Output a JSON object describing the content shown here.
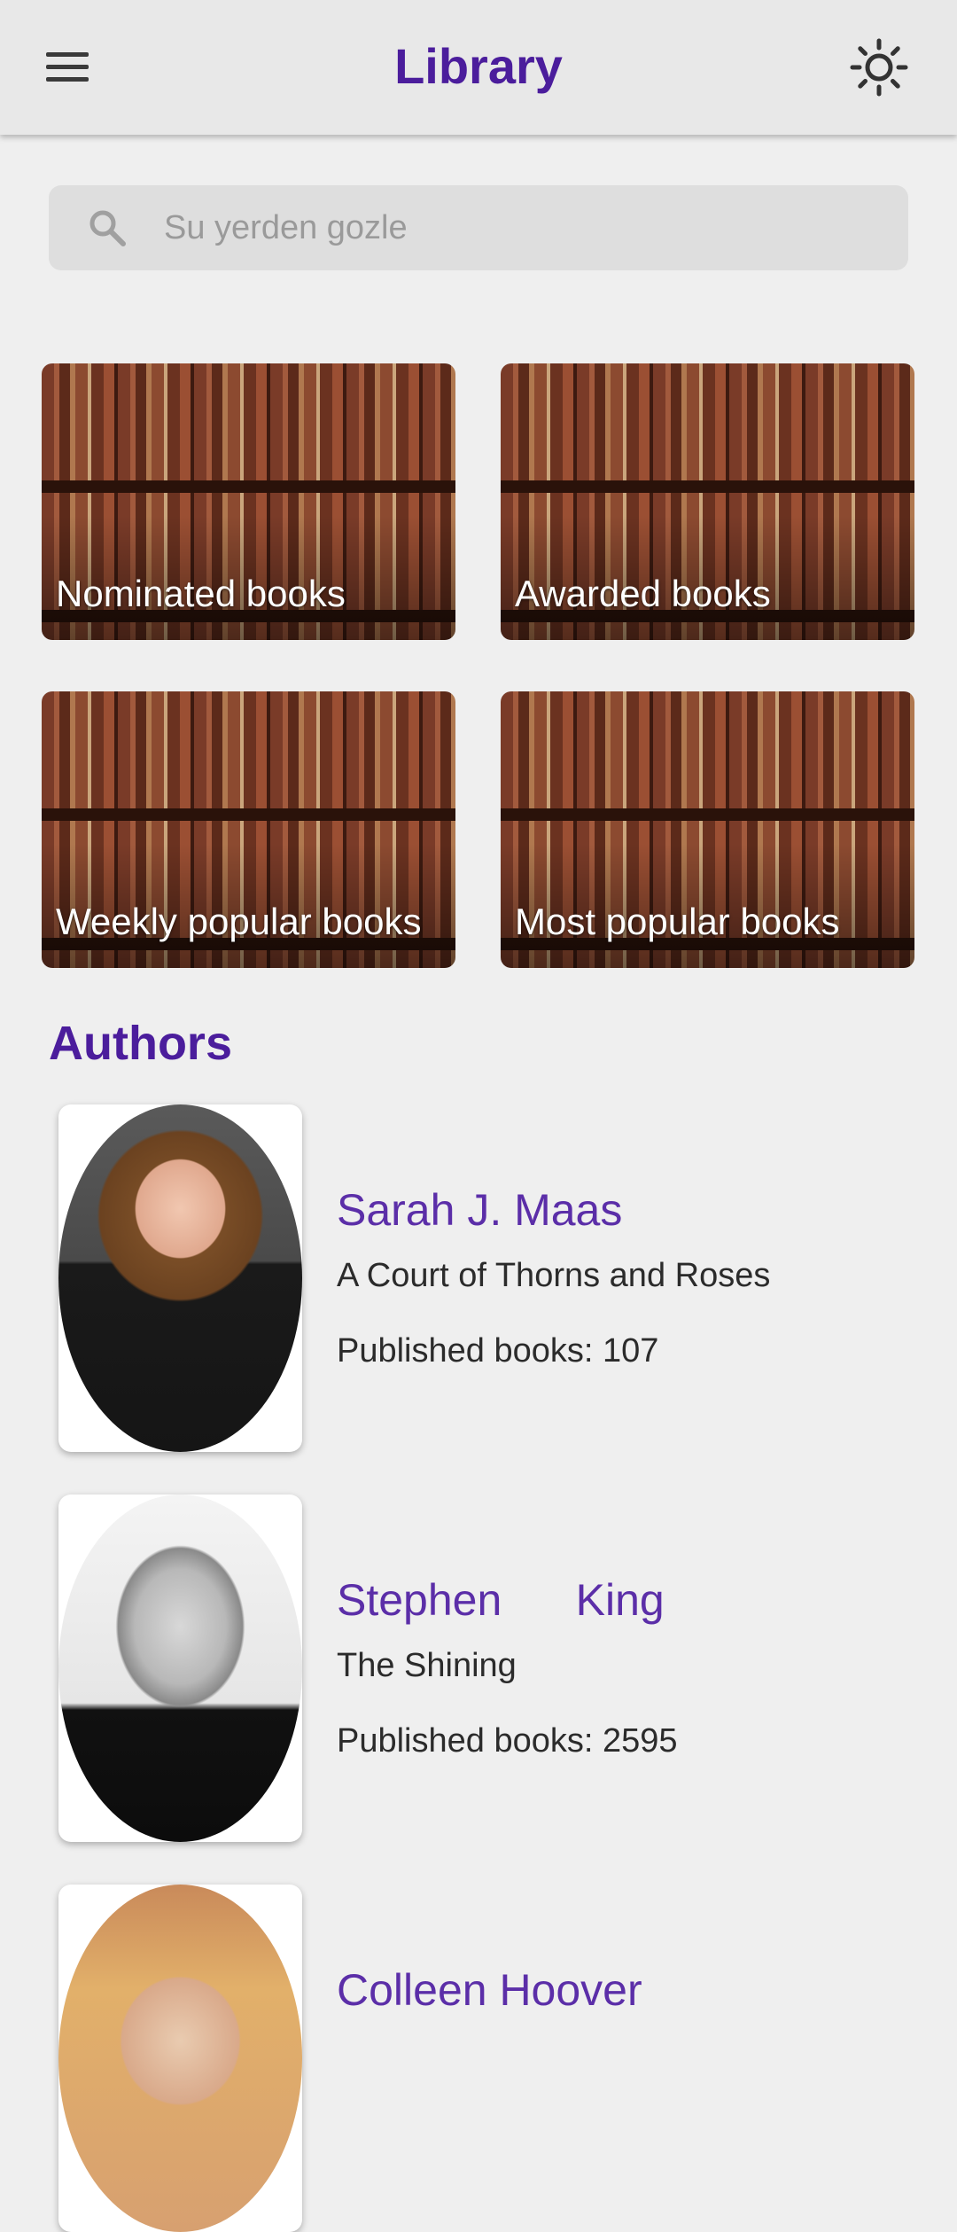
{
  "app_bar": {
    "title": "Library",
    "menu_icon": "hamburger-menu-icon",
    "theme_icon": "sun-icon"
  },
  "search": {
    "placeholder": "Su yerden gozle",
    "value": "",
    "icon": "search-icon"
  },
  "categories": [
    {
      "label": "Nominated books"
    },
    {
      "label": "Awarded books"
    },
    {
      "label": "Weekly popular books"
    },
    {
      "label": "Most popular books"
    }
  ],
  "authors_section": {
    "title": "Authors",
    "items": [
      {
        "name": "Sarah J. Maas",
        "book": "A Court of Thorns and Roses",
        "published": "Published books: 107"
      },
      {
        "name": "Stephen      King",
        "book": "The Shining",
        "published": "Published books: 2595"
      },
      {
        "name": "Colleen Hoover",
        "book": "",
        "published": ""
      }
    ]
  },
  "colors": {
    "accent": "#4b1d9c",
    "author_name": "#5b2ea8",
    "background": "#efefef",
    "app_bar": "#e8e8e8"
  }
}
